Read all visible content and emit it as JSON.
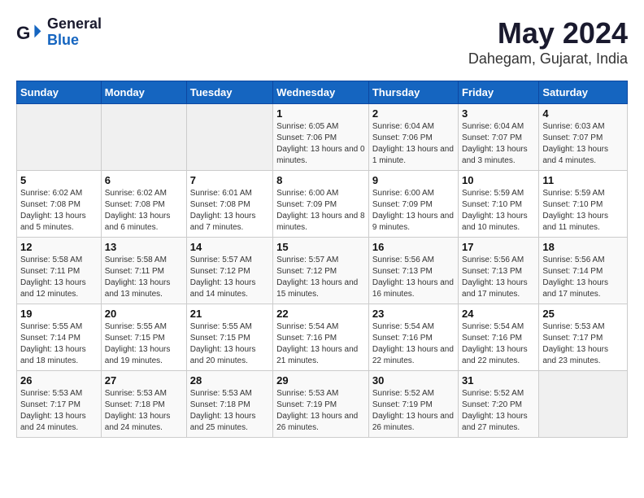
{
  "logo": {
    "general": "General",
    "blue": "Blue"
  },
  "title": "May 2024",
  "subtitle": "Dahegam, Gujarat, India",
  "days_header": [
    "Sunday",
    "Monday",
    "Tuesday",
    "Wednesday",
    "Thursday",
    "Friday",
    "Saturday"
  ],
  "weeks": [
    [
      {
        "day": "",
        "empty": true
      },
      {
        "day": "",
        "empty": true
      },
      {
        "day": "",
        "empty": true
      },
      {
        "day": "1",
        "sunrise": "6:05 AM",
        "sunset": "7:06 PM",
        "daylight": "13 hours and 0 minutes."
      },
      {
        "day": "2",
        "sunrise": "6:04 AM",
        "sunset": "7:06 PM",
        "daylight": "13 hours and 1 minute."
      },
      {
        "day": "3",
        "sunrise": "6:04 AM",
        "sunset": "7:07 PM",
        "daylight": "13 hours and 3 minutes."
      },
      {
        "day": "4",
        "sunrise": "6:03 AM",
        "sunset": "7:07 PM",
        "daylight": "13 hours and 4 minutes."
      }
    ],
    [
      {
        "day": "5",
        "sunrise": "6:02 AM",
        "sunset": "7:08 PM",
        "daylight": "13 hours and 5 minutes."
      },
      {
        "day": "6",
        "sunrise": "6:02 AM",
        "sunset": "7:08 PM",
        "daylight": "13 hours and 6 minutes."
      },
      {
        "day": "7",
        "sunrise": "6:01 AM",
        "sunset": "7:08 PM",
        "daylight": "13 hours and 7 minutes."
      },
      {
        "day": "8",
        "sunrise": "6:00 AM",
        "sunset": "7:09 PM",
        "daylight": "13 hours and 8 minutes."
      },
      {
        "day": "9",
        "sunrise": "6:00 AM",
        "sunset": "7:09 PM",
        "daylight": "13 hours and 9 minutes."
      },
      {
        "day": "10",
        "sunrise": "5:59 AM",
        "sunset": "7:10 PM",
        "daylight": "13 hours and 10 minutes."
      },
      {
        "day": "11",
        "sunrise": "5:59 AM",
        "sunset": "7:10 PM",
        "daylight": "13 hours and 11 minutes."
      }
    ],
    [
      {
        "day": "12",
        "sunrise": "5:58 AM",
        "sunset": "7:11 PM",
        "daylight": "13 hours and 12 minutes."
      },
      {
        "day": "13",
        "sunrise": "5:58 AM",
        "sunset": "7:11 PM",
        "daylight": "13 hours and 13 minutes."
      },
      {
        "day": "14",
        "sunrise": "5:57 AM",
        "sunset": "7:12 PM",
        "daylight": "13 hours and 14 minutes."
      },
      {
        "day": "15",
        "sunrise": "5:57 AM",
        "sunset": "7:12 PM",
        "daylight": "13 hours and 15 minutes."
      },
      {
        "day": "16",
        "sunrise": "5:56 AM",
        "sunset": "7:13 PM",
        "daylight": "13 hours and 16 minutes."
      },
      {
        "day": "17",
        "sunrise": "5:56 AM",
        "sunset": "7:13 PM",
        "daylight": "13 hours and 17 minutes."
      },
      {
        "day": "18",
        "sunrise": "5:56 AM",
        "sunset": "7:14 PM",
        "daylight": "13 hours and 17 minutes."
      }
    ],
    [
      {
        "day": "19",
        "sunrise": "5:55 AM",
        "sunset": "7:14 PM",
        "daylight": "13 hours and 18 minutes."
      },
      {
        "day": "20",
        "sunrise": "5:55 AM",
        "sunset": "7:15 PM",
        "daylight": "13 hours and 19 minutes."
      },
      {
        "day": "21",
        "sunrise": "5:55 AM",
        "sunset": "7:15 PM",
        "daylight": "13 hours and 20 minutes."
      },
      {
        "day": "22",
        "sunrise": "5:54 AM",
        "sunset": "7:16 PM",
        "daylight": "13 hours and 21 minutes."
      },
      {
        "day": "23",
        "sunrise": "5:54 AM",
        "sunset": "7:16 PM",
        "daylight": "13 hours and 22 minutes."
      },
      {
        "day": "24",
        "sunrise": "5:54 AM",
        "sunset": "7:16 PM",
        "daylight": "13 hours and 22 minutes."
      },
      {
        "day": "25",
        "sunrise": "5:53 AM",
        "sunset": "7:17 PM",
        "daylight": "13 hours and 23 minutes."
      }
    ],
    [
      {
        "day": "26",
        "sunrise": "5:53 AM",
        "sunset": "7:17 PM",
        "daylight": "13 hours and 24 minutes."
      },
      {
        "day": "27",
        "sunrise": "5:53 AM",
        "sunset": "7:18 PM",
        "daylight": "13 hours and 24 minutes."
      },
      {
        "day": "28",
        "sunrise": "5:53 AM",
        "sunset": "7:18 PM",
        "daylight": "13 hours and 25 minutes."
      },
      {
        "day": "29",
        "sunrise": "5:53 AM",
        "sunset": "7:19 PM",
        "daylight": "13 hours and 26 minutes."
      },
      {
        "day": "30",
        "sunrise": "5:52 AM",
        "sunset": "7:19 PM",
        "daylight": "13 hours and 26 minutes."
      },
      {
        "day": "31",
        "sunrise": "5:52 AM",
        "sunset": "7:20 PM",
        "daylight": "13 hours and 27 minutes."
      },
      {
        "day": "",
        "empty": true
      }
    ]
  ]
}
